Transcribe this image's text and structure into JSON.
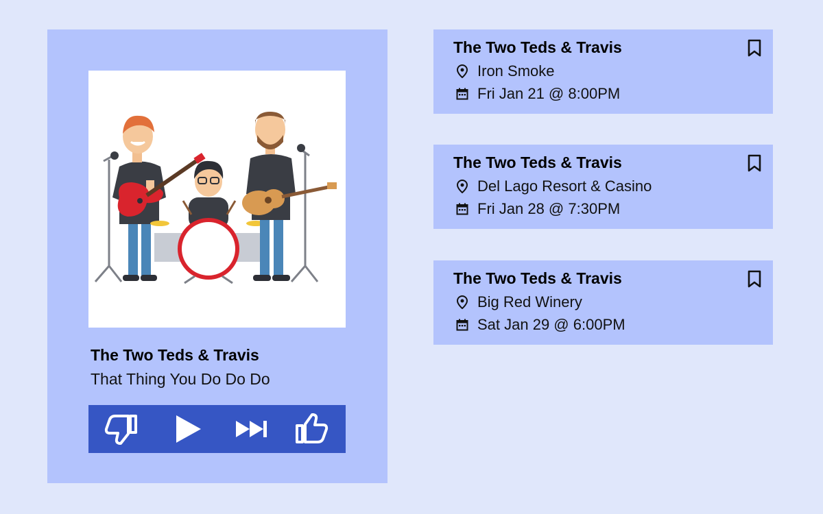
{
  "now_playing": {
    "artist": "The Two Teds & Travis",
    "song": "That Thing You Do Do Do",
    "controls": {
      "dislike_icon": "thumbs-down-icon",
      "play_icon": "play-icon",
      "next_icon": "skip-next-icon",
      "like_icon": "thumbs-up-icon"
    }
  },
  "events": [
    {
      "artist": "The Two Teds & Travis",
      "venue": "Iron Smoke",
      "datetime": "Fri Jan 21 @ 8:00PM"
    },
    {
      "artist": "The Two Teds & Travis",
      "venue": "Del Lago Resort & Casino",
      "datetime": "Fri Jan 28 @ 7:30PM"
    },
    {
      "artist": "The Two Teds & Travis",
      "venue": "Big Red Winery",
      "datetime": "Sat Jan 29 @ 6:00PM"
    }
  ],
  "colors": {
    "background": "#e0e7fb",
    "panel": "#b3c3fd",
    "controls_bar": "#3656c4"
  }
}
